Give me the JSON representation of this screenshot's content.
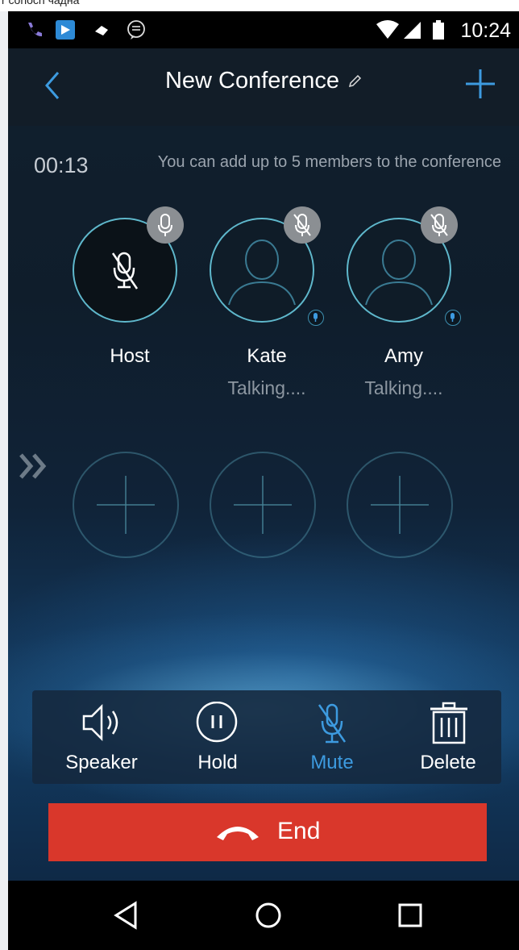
{
  "caption": "r conoch чадна",
  "status_bar": {
    "time": "10:24",
    "icons": [
      "phone-call-icon",
      "app-notification-icon",
      "cast-icon",
      "message-icon",
      "wifi-icon",
      "signal-icon",
      "battery-icon"
    ]
  },
  "header": {
    "title": "New Conference",
    "icons": [
      "back-chevron-icon",
      "edit-pencil-icon",
      "add-plus-icon"
    ]
  },
  "conference": {
    "duration": "00:13",
    "info": "You can add up to 5 members to the conference"
  },
  "members": [
    {
      "name": "Host",
      "status": "",
      "muted": true
    },
    {
      "name": "Kate",
      "status": "Talking....",
      "muted": true
    },
    {
      "name": "Amy",
      "status": "Talking....",
      "muted": true
    }
  ],
  "empty_slots": 3,
  "actions": {
    "speaker": "Speaker",
    "hold": "Hold",
    "mute": "Mute",
    "delete": "Delete",
    "active": "mute"
  },
  "end_button": {
    "label": "End"
  },
  "nav": [
    "back-triangle-icon",
    "home-circle-icon",
    "recents-square-icon"
  ],
  "colors": {
    "accent_blue": "#3d9be0",
    "end_red": "#d9372b",
    "avatar_ring": "#5fb8cc"
  }
}
